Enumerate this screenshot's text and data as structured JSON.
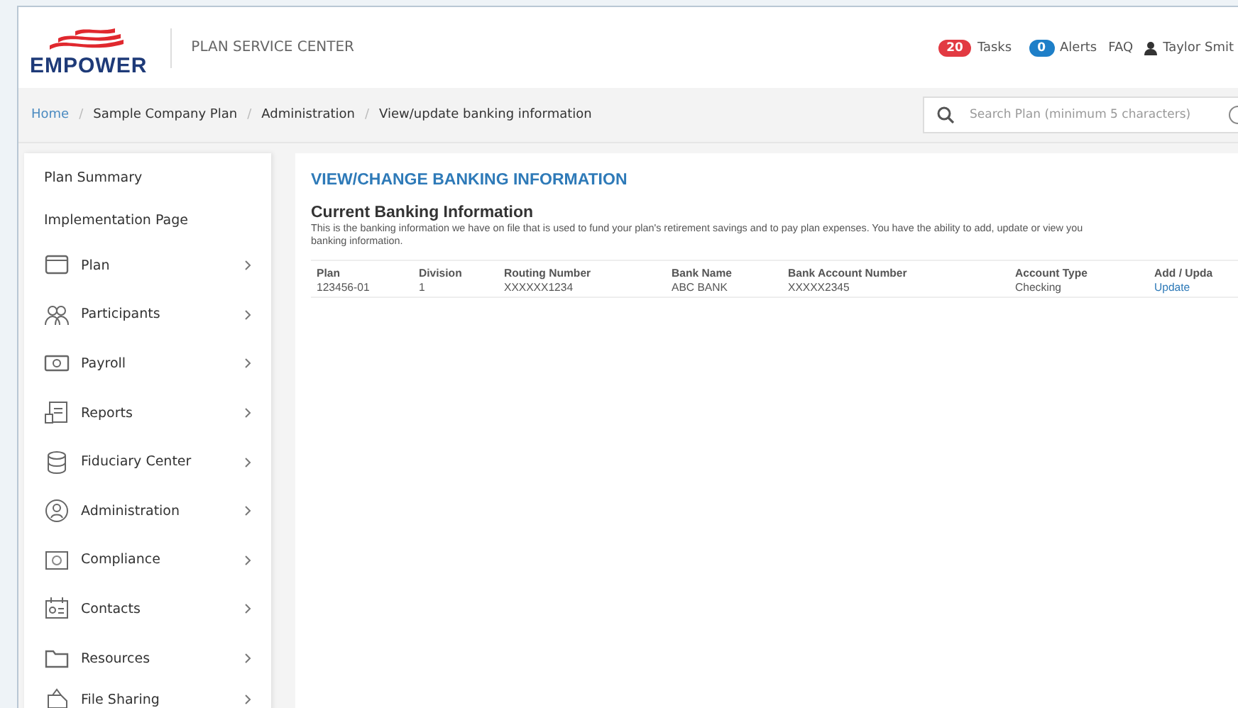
{
  "header": {
    "brand": "EMPOWER",
    "app_title": "PLAN SERVICE CENTER",
    "tasks": {
      "count": "20",
      "label": "Tasks"
    },
    "alerts": {
      "count": "0",
      "label": "Alerts"
    },
    "faq": "FAQ",
    "user": "Taylor Smit"
  },
  "breadcrumbs": {
    "separator": "/",
    "items": [
      "Home",
      "Sample Company Plan",
      "Administration",
      "View/update banking information"
    ]
  },
  "search": {
    "placeholder": "Search Plan (minimum 5 characters)"
  },
  "sidebar": {
    "items": [
      {
        "label": "Plan Summary",
        "kind": "plain"
      },
      {
        "label": "Implementation Page",
        "kind": "plain"
      },
      {
        "label": "Plan",
        "kind": "menu"
      },
      {
        "label": "Participants",
        "kind": "menu"
      },
      {
        "label": "Payroll",
        "kind": "menu"
      },
      {
        "label": "Reports",
        "kind": "menu"
      },
      {
        "label": "Fiduciary Center",
        "kind": "menu"
      },
      {
        "label": "Administration",
        "kind": "menu"
      },
      {
        "label": "Compliance",
        "kind": "menu"
      },
      {
        "label": "Contacts",
        "kind": "menu"
      },
      {
        "label": "Resources",
        "kind": "menu"
      },
      {
        "label": "File Sharing",
        "kind": "menu"
      }
    ]
  },
  "main": {
    "title": "VIEW/CHANGE BANKING INFORMATION",
    "section_title": "Current Banking Information",
    "description": "This is the banking information we have on file that is used to fund your plan's retirement savings and to pay plan expenses. You have the ability to add, update or view you",
    "description_2": "banking information.",
    "table": {
      "columns": [
        "Plan",
        "Division",
        "Routing Number",
        "Bank Name",
        "Bank Account Number",
        "Account Type",
        "Add / Upda"
      ],
      "rows": [
        {
          "cells": [
            "123456-01",
            "1",
            "XXXXXX1234",
            "ABC BANK",
            "XXXXX2345",
            "Checking"
          ],
          "action": "Update"
        }
      ]
    }
  }
}
